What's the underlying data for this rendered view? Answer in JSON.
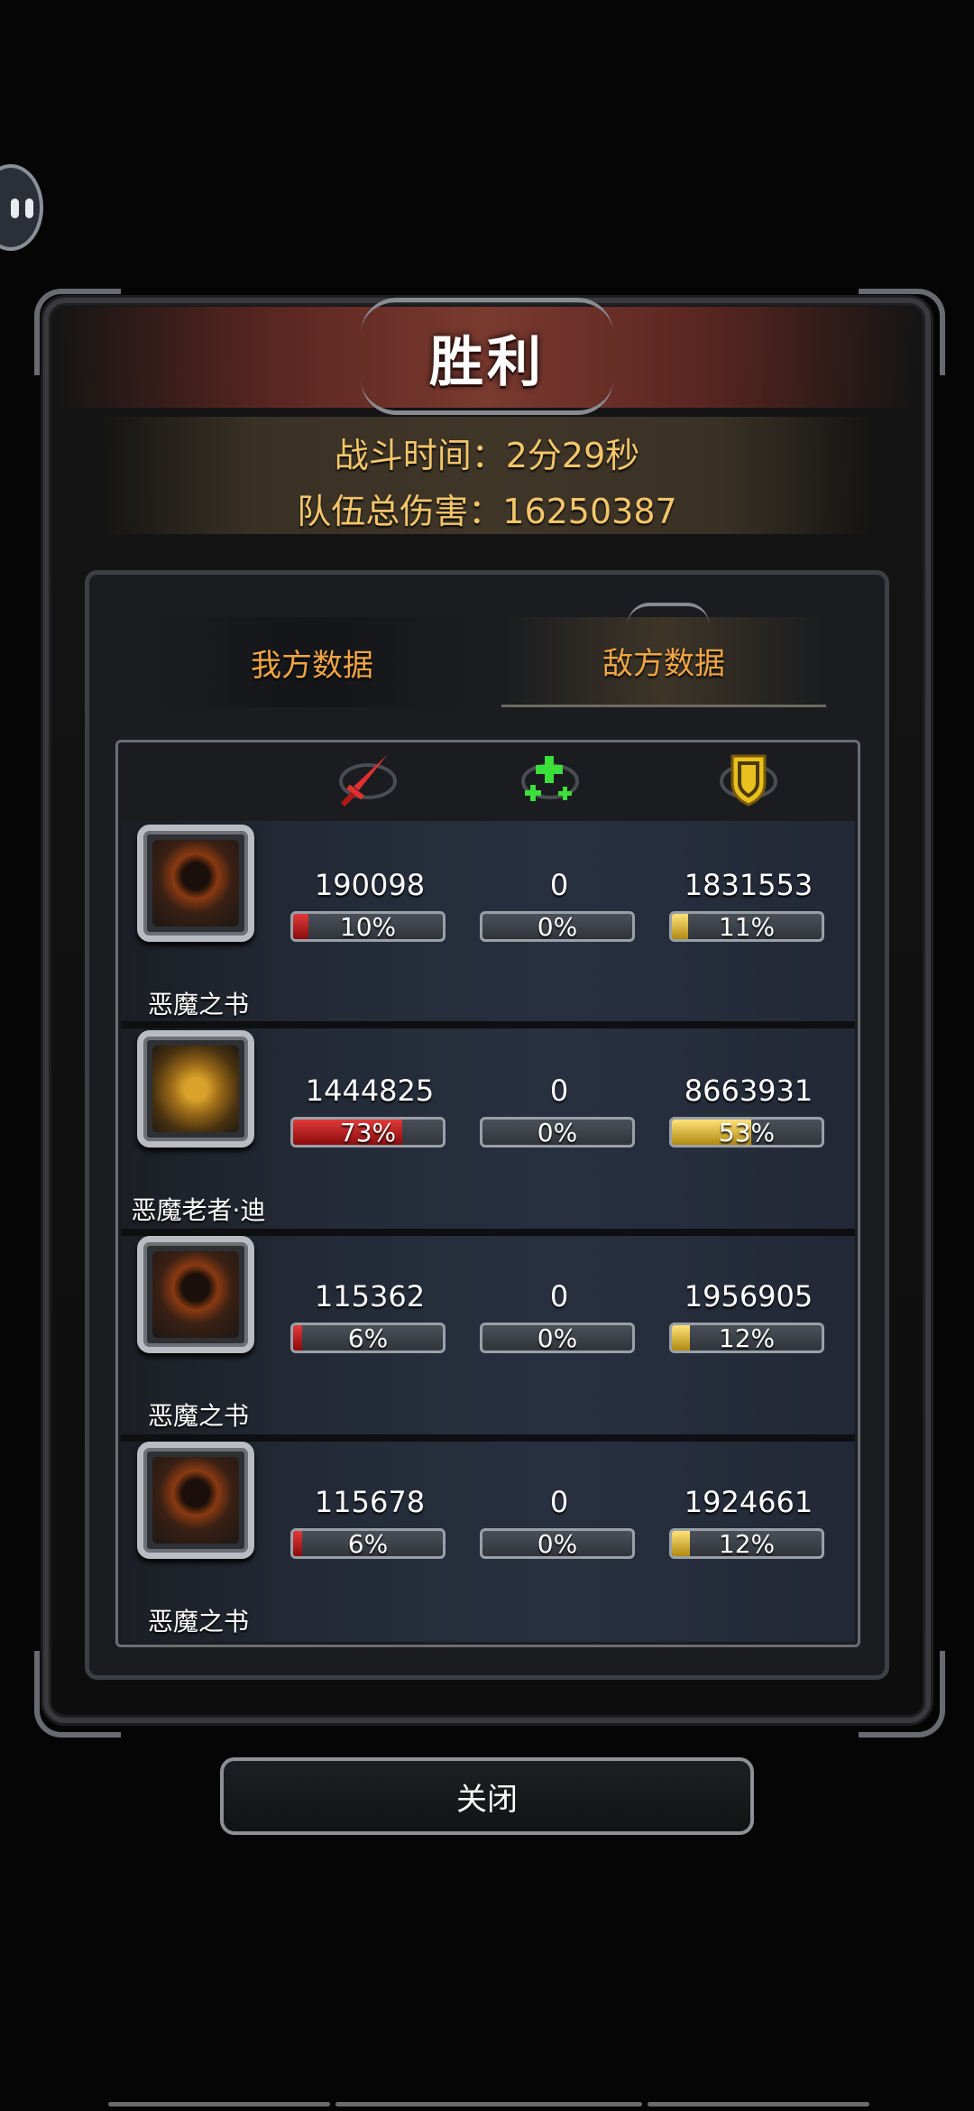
{
  "title": "胜利",
  "battle_time": "战斗时间：2分29秒",
  "team_damage": "队伍总伤害：16250387",
  "tabs": {
    "ours": "我方数据",
    "enemy": "敌方数据"
  },
  "columns": [
    {
      "icon": "sword-icon",
      "color": "#e03030"
    },
    {
      "icon": "heal-cross-icon",
      "color": "#3adf3a"
    },
    {
      "icon": "shield-icon",
      "color": "#e8c020"
    }
  ],
  "rows": [
    {
      "name": "恶魔之书",
      "portrait": "hooded-figure-icon",
      "damage": "190098",
      "damage_pct": "10%",
      "damage_frac": 0.1,
      "heal": "0",
      "heal_pct": "0%",
      "tank": "1831553",
      "tank_pct": "11%",
      "tank_frac": 0.11
    },
    {
      "name": "恶魔老者·迪",
      "portrait": "dragon-icon",
      "damage": "1444825",
      "damage_pct": "73%",
      "damage_frac": 0.73,
      "heal": "0",
      "heal_pct": "0%",
      "tank": "8663931",
      "tank_pct": "53%",
      "tank_frac": 0.53
    },
    {
      "name": "恶魔之书",
      "portrait": "hooded-figure-icon",
      "damage": "115362",
      "damage_pct": "6%",
      "damage_frac": 0.06,
      "heal": "0",
      "heal_pct": "0%",
      "tank": "1956905",
      "tank_pct": "12%",
      "tank_frac": 0.12
    },
    {
      "name": "恶魔之书",
      "portrait": "hooded-figure-icon",
      "damage": "115678",
      "damage_pct": "6%",
      "damage_frac": 0.06,
      "heal": "0",
      "heal_pct": "0%",
      "tank": "1924661",
      "tank_pct": "12%",
      "tank_frac": 0.12
    }
  ],
  "close_label": "关闭"
}
